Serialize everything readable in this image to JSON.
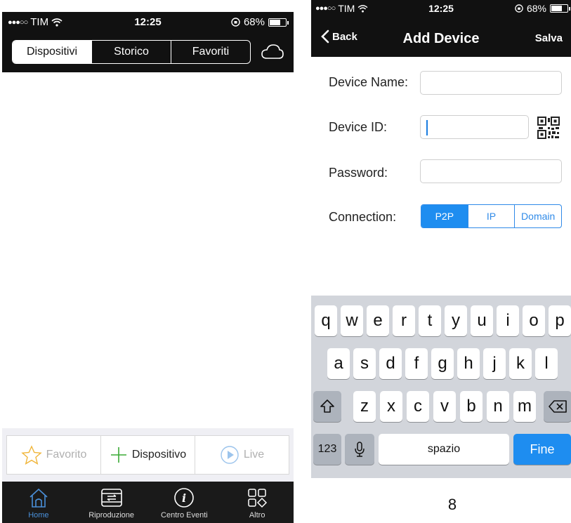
{
  "left_screen": {
    "status": {
      "carrier": "TIM",
      "time": "12:25",
      "battery": "68%",
      "battery_level": 0.68
    },
    "segments": [
      "Dispositivi",
      "Storico",
      "Favoriti"
    ],
    "active_segment": "Dispositivi",
    "toolbar": {
      "favorite": "Favorito",
      "add_device": "Dispositivo",
      "live": "Live"
    },
    "tabs": [
      {
        "label": "Home",
        "icon": "home-icon"
      },
      {
        "label": "Riproduzione",
        "icon": "film-icon"
      },
      {
        "label": "Centro Eventi",
        "icon": "info-icon"
      },
      {
        "label": "Altro",
        "icon": "grid-icon"
      }
    ],
    "active_tab": "Home",
    "colors": {
      "accent": "#4a90d9",
      "bar": "#1a1a1a"
    }
  },
  "right_screen": {
    "status": {
      "carrier": "TIM",
      "time": "12:25",
      "battery": "68%",
      "battery_level": 0.68
    },
    "nav": {
      "back": "Back",
      "title": "Add Device",
      "save": "Salva"
    },
    "form": {
      "device_name_label": "Device Name:",
      "device_name_value": "",
      "device_id_label": "Device ID:",
      "device_id_value": "",
      "password_label": "Password:",
      "password_value": "",
      "connection_label": "Connection:",
      "connection_options": [
        "P2P",
        "IP",
        "Domain"
      ],
      "connection_selected": "P2P"
    },
    "keyboard": {
      "row1": [
        "q",
        "w",
        "e",
        "r",
        "t",
        "y",
        "u",
        "i",
        "o",
        "p"
      ],
      "row2": [
        "a",
        "s",
        "d",
        "f",
        "g",
        "h",
        "j",
        "k",
        "l"
      ],
      "row3": [
        "z",
        "x",
        "c",
        "v",
        "b",
        "n",
        "m"
      ],
      "numbers_key": "123",
      "space_key": "spazio",
      "done_key": "Fine"
    },
    "colors": {
      "accent": "#1e8df0"
    }
  },
  "page_number": "8"
}
